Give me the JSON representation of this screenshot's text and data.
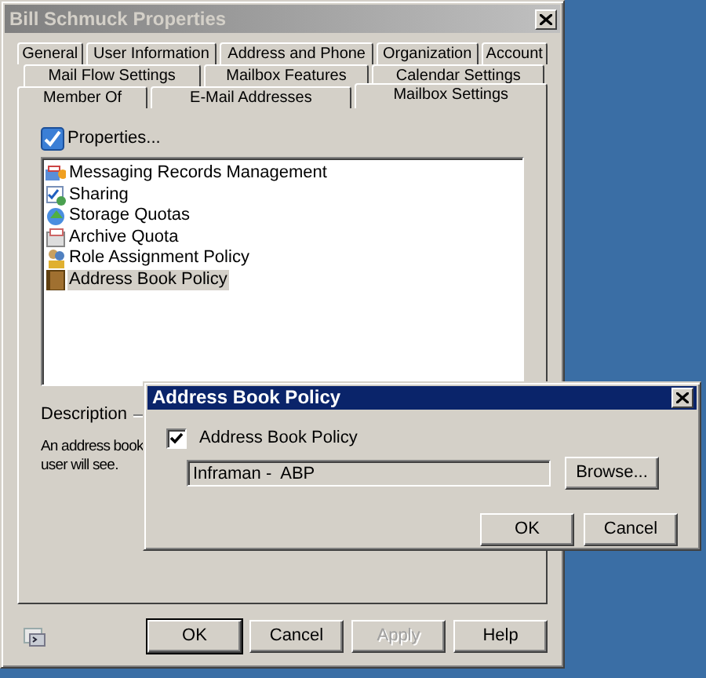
{
  "window": {
    "title": "Bill Schmuck Properties"
  },
  "tab_rows": [
    [
      {
        "label": "General",
        "selected": false
      },
      {
        "label": "User Information",
        "selected": false
      },
      {
        "label": "Address and Phone",
        "selected": false
      },
      {
        "label": "Organization",
        "selected": false
      },
      {
        "label": "Account",
        "selected": false
      }
    ],
    [
      {
        "label": "Mail Flow Settings",
        "selected": false
      },
      {
        "label": "Mailbox Features",
        "selected": false
      },
      {
        "label": "Calendar Settings",
        "selected": false
      }
    ],
    [
      {
        "label": "Member Of",
        "selected": false
      },
      {
        "label": "E-Mail Addresses",
        "selected": false
      },
      {
        "label": "Mailbox Settings",
        "selected": true
      }
    ]
  ],
  "properties_button": {
    "label": "Properties..."
  },
  "settings_list": [
    {
      "label": "Messaging Records Management",
      "kind": "records",
      "selected": false
    },
    {
      "label": "Sharing",
      "kind": "sharing",
      "selected": false
    },
    {
      "label": "Storage Quotas",
      "kind": "storage",
      "selected": false
    },
    {
      "label": "Archive Quota",
      "kind": "archive",
      "selected": false
    },
    {
      "label": "Role Assignment Policy",
      "kind": "role",
      "selected": false
    },
    {
      "label": "Address Book Policy",
      "kind": "book",
      "selected": true
    }
  ],
  "description": {
    "legend": "Description",
    "lines": [
      "An address book",
      "user will see."
    ]
  },
  "buttons": [
    {
      "label": "OK",
      "disabled": false,
      "default": true
    },
    {
      "label": "Cancel",
      "disabled": false,
      "default": false
    },
    {
      "label": "Apply",
      "disabled": true,
      "default": false
    },
    {
      "label": "Help",
      "disabled": false,
      "default": false
    }
  ],
  "dialog": {
    "title": "Address Book Policy",
    "checkbox": {
      "label": "Address Book Policy",
      "checked": true
    },
    "field": {
      "value": "Inframan -  ABP"
    },
    "browse": "Browse...",
    "buttons": [
      {
        "label": "OK",
        "disabled": false,
        "default": false
      },
      {
        "label": "Cancel",
        "disabled": false,
        "default": false
      }
    ]
  }
}
